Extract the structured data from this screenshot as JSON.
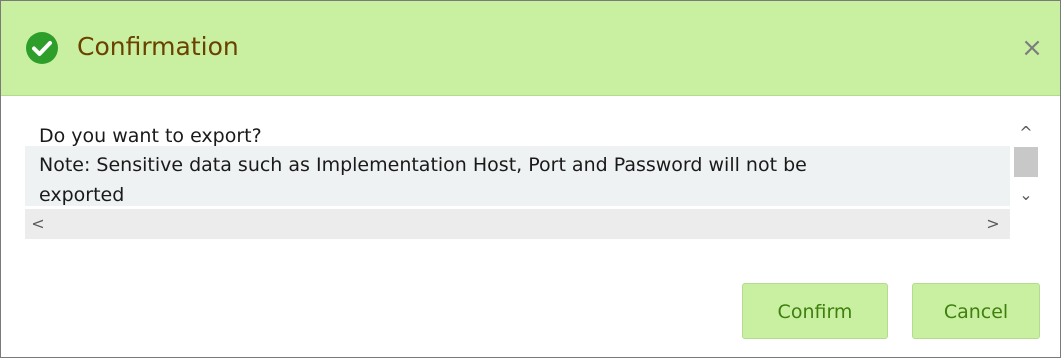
{
  "dialog": {
    "title": "Confirmation",
    "title_icon": "check-circle-icon",
    "close_icon": "close-icon",
    "close_glyph": "×",
    "message_lines": [
      "Do you want to export?",
      "Note: Sensitive data such as Implementation Host, Port and Password will not be",
      "exported"
    ],
    "buttons": {
      "confirm_label": "Confirm",
      "cancel_label": "Cancel"
    },
    "scroll_glyphs": {
      "up": "^",
      "down": "⌄",
      "left": "<",
      "right": ">"
    }
  },
  "colors": {
    "header_background": "#c9f0a0",
    "title_text": "#6b4100",
    "check_icon": "#2e9e2a",
    "button_background": "#c9f0a0",
    "button_text": "#3f7f0f"
  }
}
